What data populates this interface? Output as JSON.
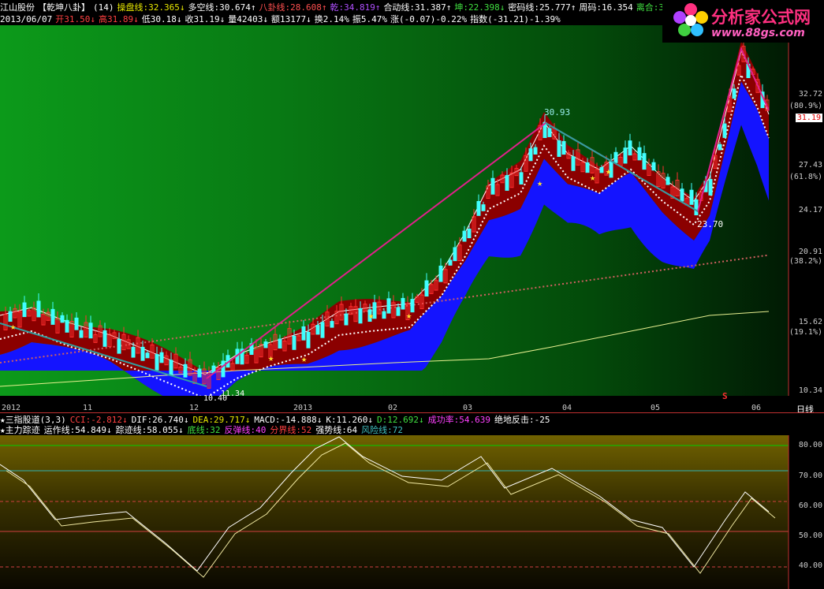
{
  "header": {
    "stock_name": "江山股份",
    "indicator_name": "【乾坤八卦】",
    "indicator_param": "(14)",
    "line1": [
      {
        "label": "操盘线:32.365↓",
        "color": "#e8e800"
      },
      {
        "label": "多空线:30.674↑",
        "color": "#ffffff"
      },
      {
        "label": "八卦线:28.608↑",
        "color": "#ff5050"
      },
      {
        "label": "乾:34.819↑",
        "color": "#b050ff"
      },
      {
        "label": "合动线:31.387↑",
        "color": "#ffffff"
      },
      {
        "label": "坤:22.398↓",
        "color": "#40e040"
      },
      {
        "label": "密码线:25.777↑",
        "color": "#ffffff"
      },
      {
        "label": "周码:16.354",
        "color": "#ffffff"
      },
      {
        "label": "离合:3",
        "color": "#40e040"
      }
    ],
    "line2": [
      {
        "label": "2013/06/07",
        "color": "#ffffff"
      },
      {
        "label": "开31.50↓",
        "color": "#ff4040"
      },
      {
        "label": "高31.89↓",
        "color": "#ff4040"
      },
      {
        "label": "低30.18↓",
        "color": "#ffffff"
      },
      {
        "label": "收31.19↓",
        "color": "#ffffff"
      },
      {
        "label": "量42403↓",
        "color": "#ffffff"
      },
      {
        "label": "额13177↓",
        "color": "#ffffff"
      },
      {
        "label": "换2.14%",
        "color": "#ffffff"
      },
      {
        "label": "振5.47%",
        "color": "#ffffff"
      },
      {
        "label": "涨(-0.07)-0.22%",
        "color": "#ffffff"
      },
      {
        "label": "指数(-31.21)-1.39%",
        "color": "#ffffff"
      }
    ]
  },
  "logo": {
    "title": "分析家公式网",
    "url": "www.88gs.com"
  },
  "main_scale": {
    "labels": [
      "32.72",
      "(80.9%)",
      "31.19",
      "27.43",
      "(61.8%)",
      "24.17",
      "20.91",
      "(38.2%)",
      "15.62",
      "(19.1%)",
      "10.34"
    ]
  },
  "x_axis": {
    "labels": [
      "2012",
      "11",
      "12",
      "2013",
      "02",
      "03",
      "04",
      "05",
      "06"
    ],
    "scale_button": "日线",
    "marker": "S"
  },
  "annotations": {
    "high": "30.93",
    "low_mid": "23.70",
    "low_start": "10.40",
    "low_start2": "11.34"
  },
  "indicator1": [
    {
      "label": "★三指股道(3,3)",
      "color": "#ffffff"
    },
    {
      "label": "CCI:-2.812↓",
      "color": "#ff4040"
    },
    {
      "label": "DIF:26.740↓",
      "color": "#ffffff"
    },
    {
      "label": "DEA:29.717↓",
      "color": "#e8e800"
    },
    {
      "label": "MACD:-14.888↓",
      "color": "#ffffff"
    },
    {
      "label": "K:11.260↓",
      "color": "#ffffff"
    },
    {
      "label": "D:12.692↓",
      "color": "#40e040"
    },
    {
      "label": "成功率:54.639",
      "color": "#ff40ff"
    },
    {
      "label": "绝地反击:-25",
      "color": "#ffffff"
    }
  ],
  "indicator2": [
    {
      "label": "★主力踪迹",
      "color": "#ffffff"
    },
    {
      "label": "运作线:54.849↓",
      "color": "#ffffff"
    },
    {
      "label": "踪迹线:58.055↓",
      "color": "#ffffff"
    },
    {
      "label": "底线:32",
      "color": "#40e040"
    },
    {
      "label": "反弹线:40",
      "color": "#ff40ff"
    },
    {
      "label": "分界线:52",
      "color": "#ff4040"
    },
    {
      "label": "强势线:64",
      "color": "#ffffff"
    },
    {
      "label": "风险线:72",
      "color": "#40c0c0"
    }
  ],
  "osc_scale": {
    "labels": [
      "80.00",
      "70.00",
      "60.00",
      "50.00",
      "40.00"
    ]
  },
  "colors": {
    "up": "#ff3030",
    "down": "#40ffff",
    "band_red": "#8b0000",
    "band_blue": "#1414ff"
  }
}
